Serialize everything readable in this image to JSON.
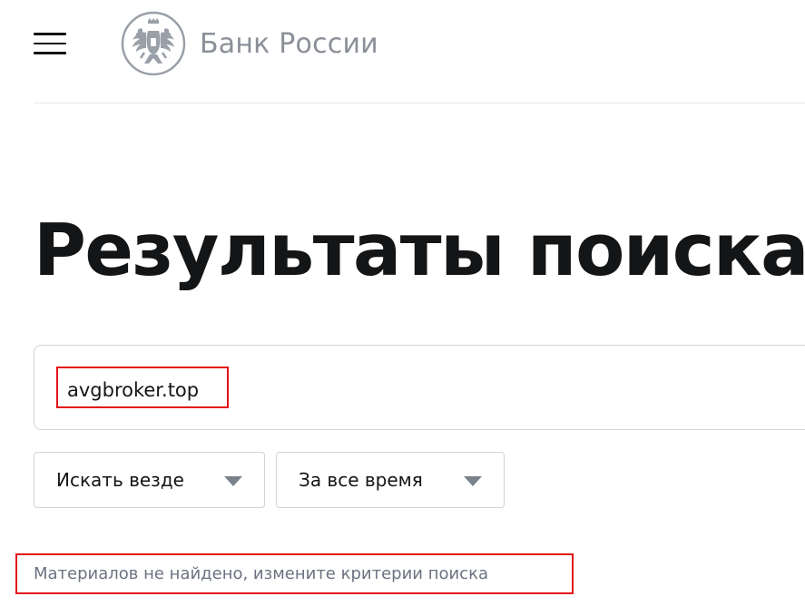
{
  "header": {
    "logo_text": "Банк России",
    "logo_icon": "double-headed-eagle-emblem",
    "menu_icon": "hamburger-menu-icon"
  },
  "page": {
    "title": "Результаты поиска"
  },
  "search": {
    "query": "avgbroker.top"
  },
  "filters": {
    "scope": {
      "selected": "Искать везде",
      "icon": "chevron-down-icon"
    },
    "period": {
      "selected": "За все время",
      "icon": "chevron-down-icon"
    }
  },
  "results": {
    "empty_message": "Материалов не найдено, измените критерии поиска"
  },
  "colors": {
    "text": "#131517",
    "logo_gray": "#8a8f98",
    "muted_text": "#6b7280",
    "border": "#d0d4d9",
    "annotation_red": "#e3111a"
  }
}
